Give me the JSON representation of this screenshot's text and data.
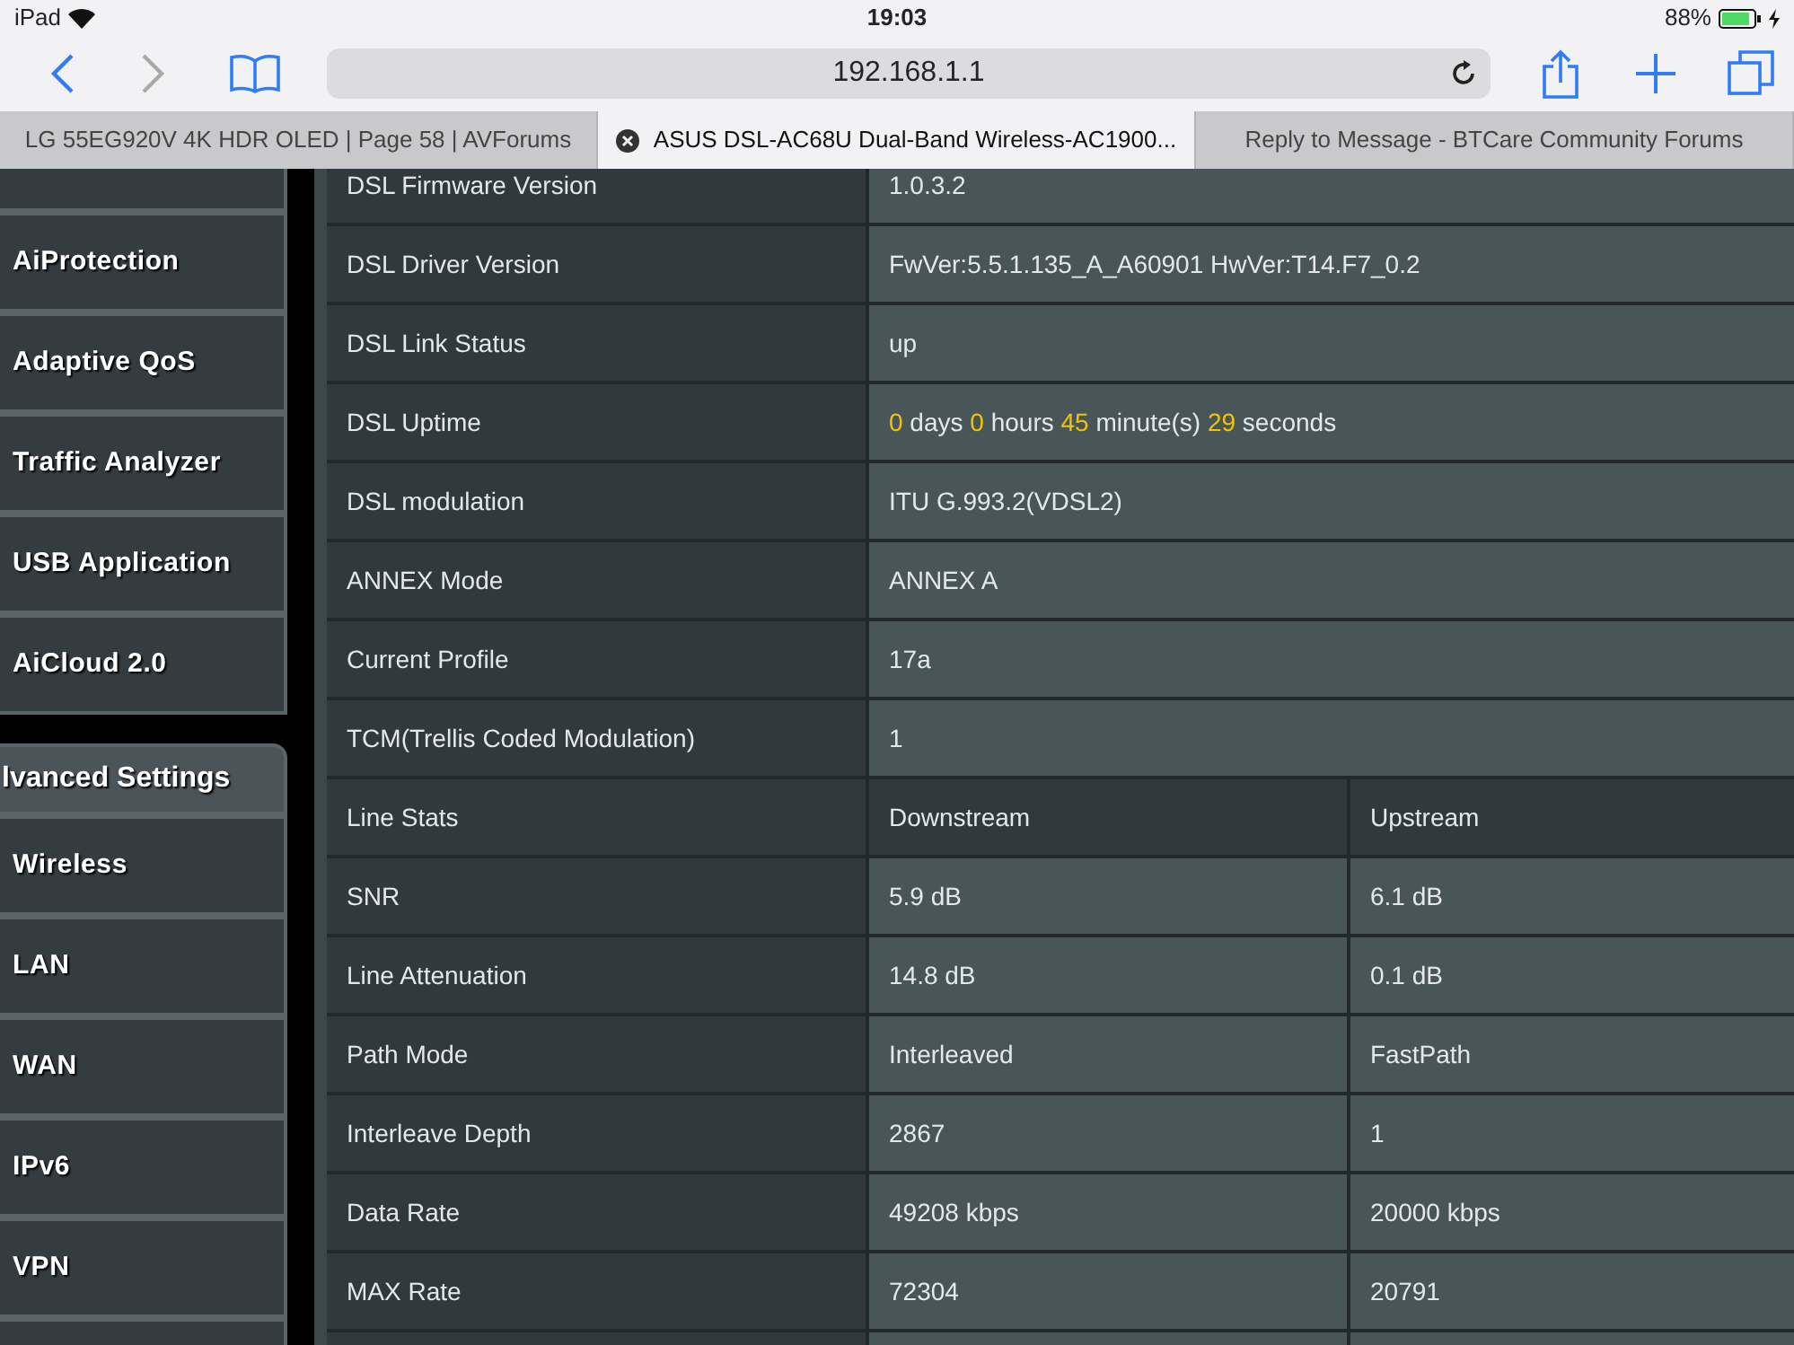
{
  "status_bar": {
    "device": "iPad",
    "time": "19:03",
    "battery": "88%"
  },
  "toolbar": {
    "url": "192.168.1.1"
  },
  "tabs": [
    {
      "label": "LG 55EG920V 4K HDR OLED | Page 58 | AVForums",
      "selected": false
    },
    {
      "label": "ASUS DSL-AC68U Dual-Band Wireless-AC1900...",
      "selected": true
    },
    {
      "label": "Reply to Message - BTCare Community Forums",
      "selected": false
    }
  ],
  "sidebar": {
    "items": [
      {
        "kind": "item"
      },
      {
        "kind": "item",
        "label": "AiProtection"
      },
      {
        "kind": "item",
        "label": "Adaptive QoS"
      },
      {
        "kind": "item",
        "label": "Traffic Analyzer"
      },
      {
        "kind": "item",
        "label": "USB Application"
      },
      {
        "kind": "item",
        "label": "AiCloud 2.0"
      },
      {
        "kind": "header",
        "label": "lvanced Settings"
      },
      {
        "kind": "item",
        "label": "Wireless"
      },
      {
        "kind": "item",
        "label": "LAN"
      },
      {
        "kind": "item",
        "label": "WAN"
      },
      {
        "kind": "item",
        "label": "IPv6"
      },
      {
        "kind": "item",
        "label": "VPN"
      },
      {
        "kind": "item"
      }
    ]
  },
  "table": {
    "rows": [
      {
        "kind": "pair",
        "label": "DSL Firmware Version",
        "value": "1.0.3.2"
      },
      {
        "kind": "pair",
        "label": "DSL Driver Version",
        "value": "FwVer:5.5.1.135_A_A60901 HwVer:T14.F7_0.2"
      },
      {
        "kind": "pair",
        "label": "DSL Link Status",
        "value": "up"
      },
      {
        "kind": "uptime",
        "label": "DSL Uptime",
        "parts": [
          {
            "kind": "number",
            "text": "0"
          },
          {
            "kind": "unit",
            "text": " days "
          },
          {
            "kind": "number",
            "text": "0"
          },
          {
            "kind": "unit",
            "text": " hours "
          },
          {
            "kind": "number",
            "text": "45"
          },
          {
            "kind": "unit",
            "text": " minute(s) "
          },
          {
            "kind": "number",
            "text": "29"
          },
          {
            "kind": "unit",
            "text": " seconds"
          }
        ]
      },
      {
        "kind": "pair",
        "label": "DSL modulation",
        "value": "ITU G.993.2(VDSL2)"
      },
      {
        "kind": "pair",
        "label": "ANNEX Mode",
        "value": "ANNEX A"
      },
      {
        "kind": "pair",
        "label": "Current Profile",
        "value": "17a"
      },
      {
        "kind": "pair",
        "label": "TCM(Trellis Coded Modulation)",
        "value": "1"
      },
      {
        "kind": "header",
        "label": "Line Stats",
        "down": "Downstream",
        "up": "Upstream"
      },
      {
        "kind": "stats",
        "label": "SNR",
        "down": "5.9 dB",
        "up": "6.1 dB"
      },
      {
        "kind": "stats",
        "label": "Line Attenuation",
        "down": "14.8 dB",
        "up": "0.1 dB"
      },
      {
        "kind": "stats",
        "label": "Path Mode",
        "down": "Interleaved",
        "up": "FastPath"
      },
      {
        "kind": "stats",
        "label": "Interleave Depth",
        "down": "2867",
        "up": "1"
      },
      {
        "kind": "stats",
        "label": "Data Rate",
        "down": "49208 kbps",
        "up": "20000 kbps"
      },
      {
        "kind": "stats",
        "label": "MAX Rate",
        "down": "72304",
        "up": "20791"
      },
      {
        "kind": "stats"
      }
    ]
  }
}
